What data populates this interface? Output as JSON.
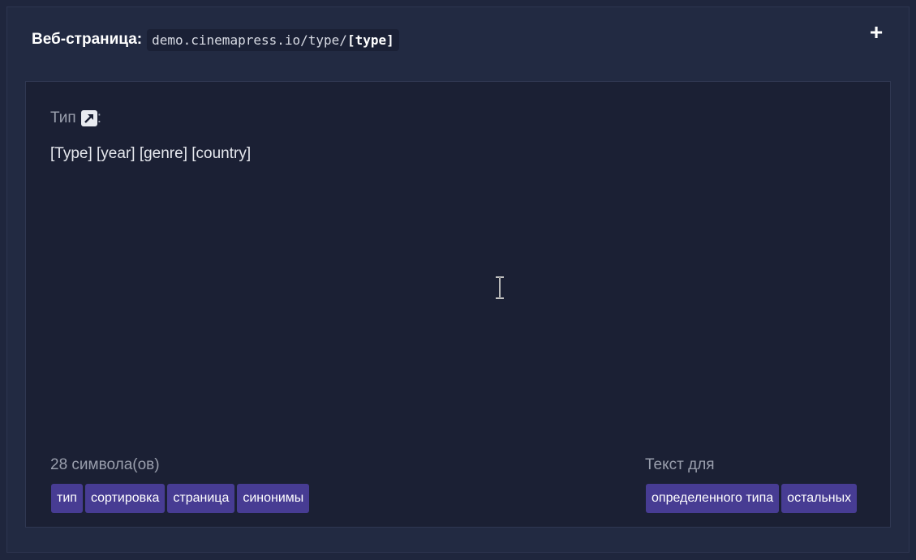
{
  "header": {
    "label": "Веб-страница:",
    "url_prefix": "demo.cinemapress.io/type/",
    "url_placeholder": "[type]",
    "add_icon": "plus-icon"
  },
  "field": {
    "label": "Тип",
    "label_suffix": ":",
    "link_icon": "external-link-icon",
    "value": "[Type] [year] [genre] [country]"
  },
  "footer": {
    "char_count": "28 символа(ов)",
    "text_for_label": "Текст для",
    "tags_left": [
      "тип",
      "сортировка",
      "страница",
      "синонимы"
    ],
    "tags_right": [
      "определенного типа",
      "остальных"
    ]
  },
  "colors": {
    "background": "#1f263d",
    "panel": "#1b2034",
    "tag": "#473c93"
  }
}
